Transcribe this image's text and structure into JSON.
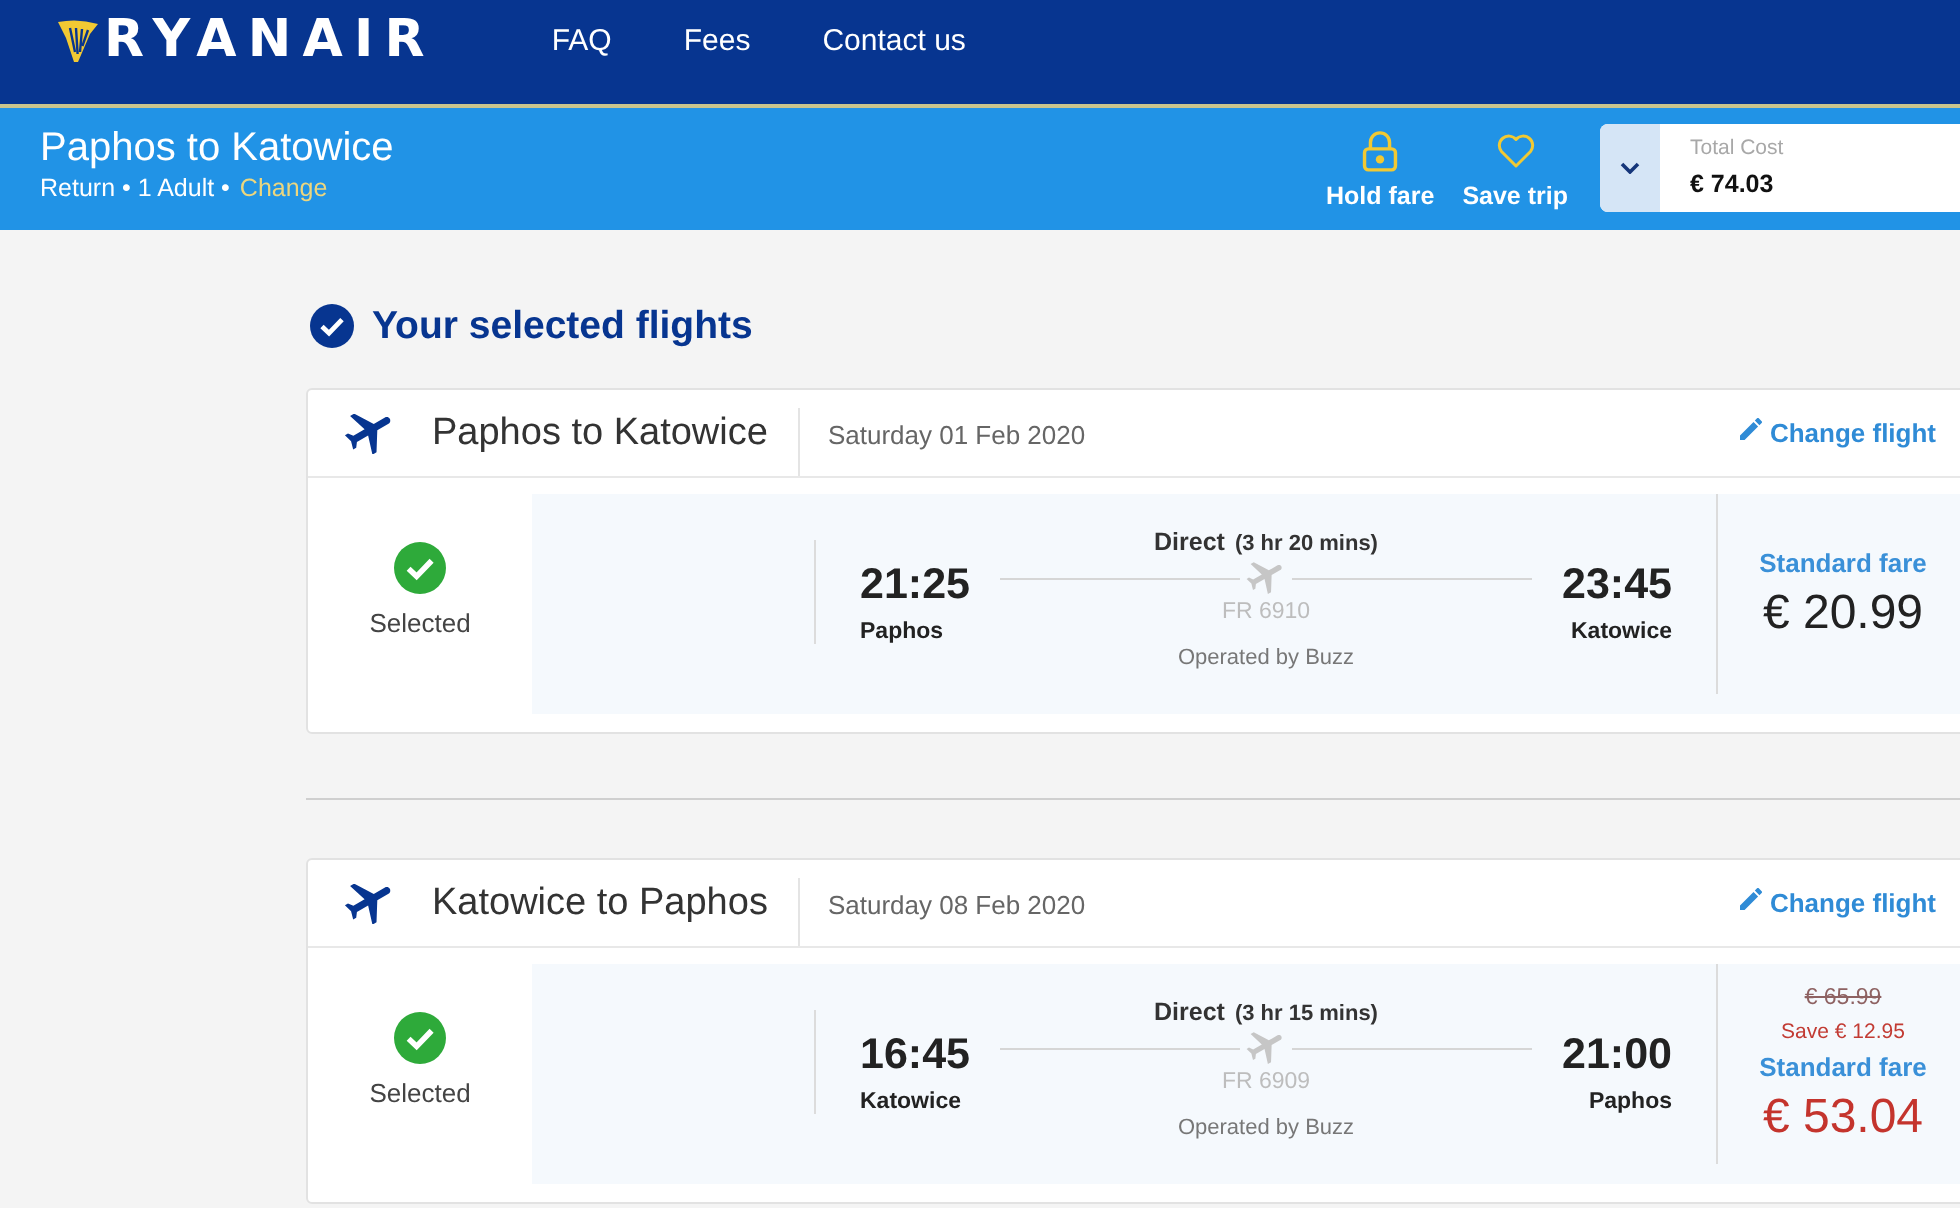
{
  "header": {
    "logo": "RYANAIR",
    "nav": [
      "FAQ",
      "Fees",
      "Contact us"
    ]
  },
  "trip_bar": {
    "title": "Paphos to Katowice",
    "summary": "Return • 1 Adult •",
    "change_link": "Change",
    "actions": [
      {
        "kind": "lock",
        "label": "Hold fare"
      },
      {
        "kind": "heart",
        "label": "Save trip"
      }
    ],
    "total": {
      "label": "Total Cost",
      "value": "€ 74.03"
    }
  },
  "section_title": "Your selected flights",
  "flights": [
    {
      "route": "Paphos to Katowice",
      "date": "Saturday 01 Feb 2020",
      "change_link": "Change flight",
      "selected": true,
      "status": "Selected",
      "departure": {
        "time": "21:25",
        "city": "Paphos"
      },
      "stops": "Direct",
      "duration": "(3 hr 20 mins)",
      "flight_number": "FR 6910",
      "operator": "Operated by Buzz",
      "arrival": {
        "time": "23:45",
        "city": "Katowice"
      },
      "fare": "Standard fare",
      "price": "€ 20.99",
      "discounted": false
    },
    {
      "route": "Katowice to Paphos",
      "date": "Saturday 08 Feb 2020",
      "change_link": "Change flight",
      "selected": true,
      "status": "Selected",
      "departure": {
        "time": "16:45",
        "city": "Katowice"
      },
      "stops": "Direct",
      "duration": "(3 hr 15 mins)",
      "flight_number": "FR 6909",
      "operator": "Operated by Buzz",
      "arrival": {
        "time": "21:00",
        "city": "Paphos"
      },
      "original_price": "€ 65.99",
      "saving": "Save € 12.95",
      "fare": "Standard fare",
      "price": "€ 53.04",
      "discounted": true
    }
  ]
}
